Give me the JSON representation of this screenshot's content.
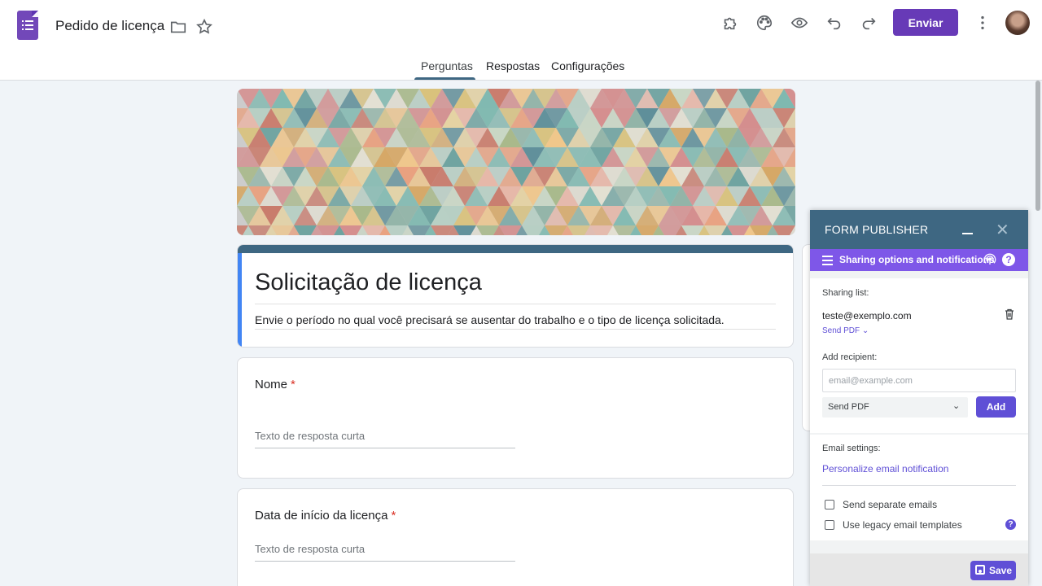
{
  "header": {
    "doc_title": "Pedido de licença",
    "send_label": "Enviar"
  },
  "tabs": [
    {
      "label": "Perguntas",
      "active": true
    },
    {
      "label": "Respostas",
      "active": false
    },
    {
      "label": "Configurações",
      "active": false
    }
  ],
  "form": {
    "title": "Solicitação de licença",
    "description": "Envie o período no qual você precisará se ausentar do trabalho e o tipo de licença solicitada.",
    "questions": [
      {
        "label": "Nome",
        "required": "*",
        "answer_placeholder": "Texto de resposta curta"
      },
      {
        "label": "Data de início da licença",
        "required": "*",
        "answer_placeholder": "Texto de resposta curta"
      }
    ]
  },
  "publisher": {
    "title": "FORM PUBLISHER",
    "subtitle": "Sharing options and notifications",
    "sharing_list_label": "Sharing list:",
    "recipients": [
      {
        "email": "teste@exemplo.com",
        "action": "Send PDF"
      }
    ],
    "add_recipient_label": "Add recipient:",
    "email_placeholder": "email@example.com",
    "send_option": "Send PDF",
    "add_label": "Add",
    "email_settings_label": "Email settings:",
    "personalize_link": "Personalize email notification",
    "send_separate": "Send separate emails",
    "legacy_templates": "Use legacy email templates",
    "save_label": "Save"
  },
  "colors": {
    "accent": "#673ab7",
    "theme": "#3e6782",
    "publisher_purple": "#7e57e8"
  }
}
